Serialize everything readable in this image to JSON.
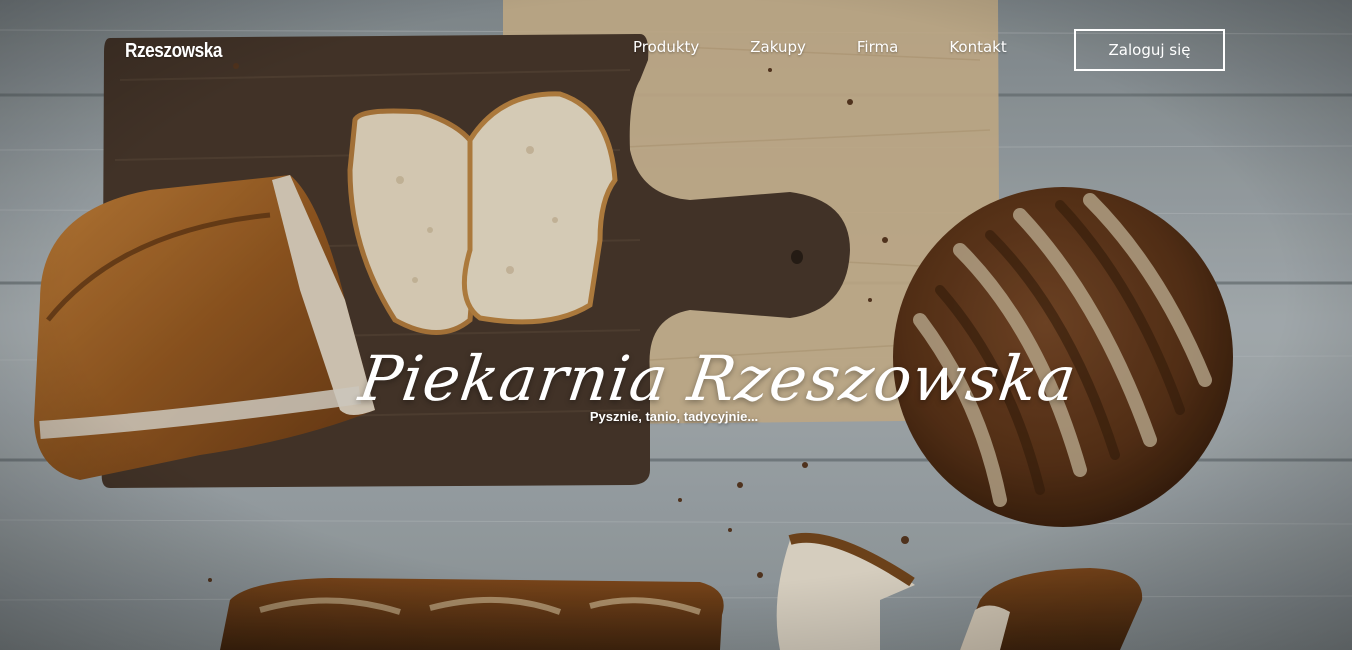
{
  "header": {
    "brand": "Rzeszowska",
    "nav": [
      {
        "label": "Produkty"
      },
      {
        "label": "Zakupy"
      },
      {
        "label": "Firma"
      },
      {
        "label": "Kontakt"
      }
    ],
    "login_label": "Zaloguj się"
  },
  "hero": {
    "title": "Piekarnia Rzeszowska",
    "subtitle": "Pysznie, tanio, tadycyjnie..."
  },
  "colors": {
    "table_wood": "#a9b1b5",
    "board_wood": "#4a3a2d",
    "parchment": "#d9c09a",
    "crust": "#8a5424",
    "crumb": "#ece2cf",
    "text": "#ffffff"
  }
}
